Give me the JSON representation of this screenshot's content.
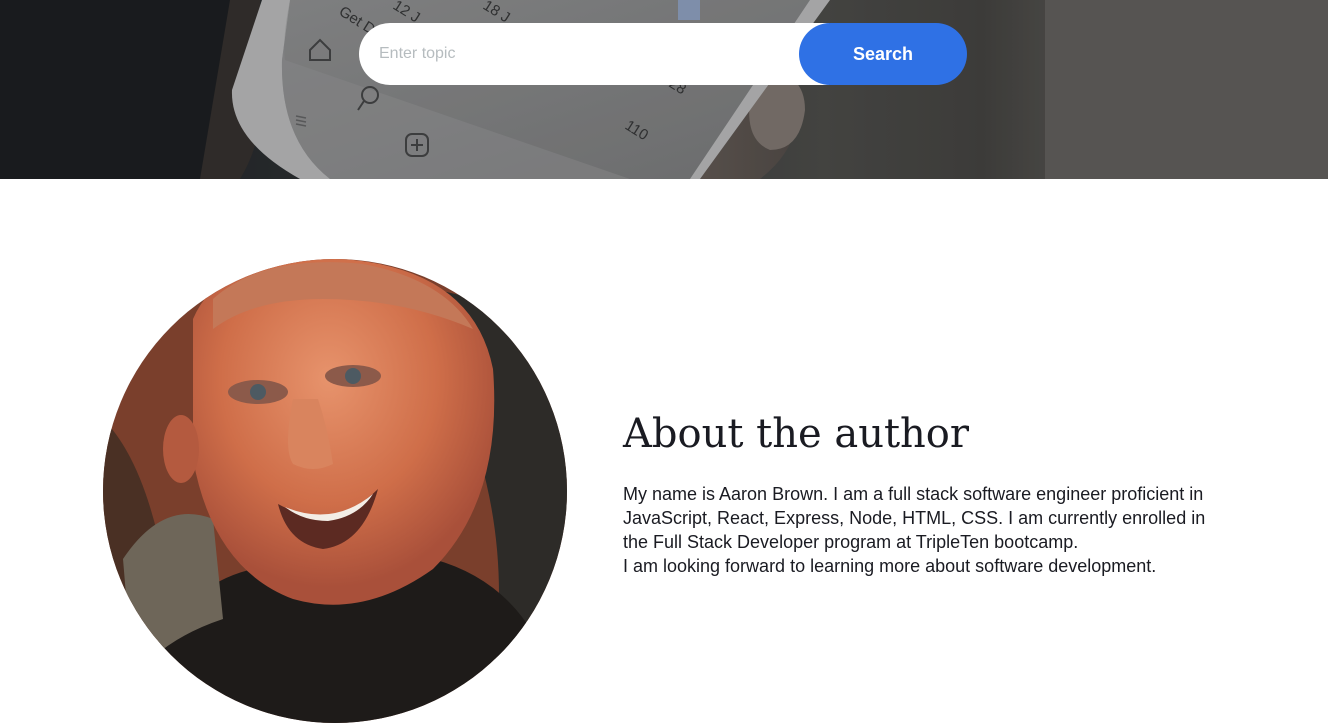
{
  "search": {
    "placeholder": "Enter topic",
    "value": "",
    "button_label": "Search"
  },
  "about": {
    "title": "About the author",
    "paragraph_1": "My name is Aaron Brown. I am a full stack software engineer proficient in JavaScript, React, Express, Node, HTML, CSS. I am currently enrolled in the Full Stack Developer program at TripleTen bootcamp.",
    "paragraph_2": "I am looking forward to learning more about software development."
  },
  "hero": {
    "phone_text": [
      "Get D",
      "12 J",
      "18 J",
      "28",
      "110"
    ]
  },
  "colors": {
    "accent": "#2f71e5",
    "text": "#1a1b22",
    "placeholder": "#b6bcbf",
    "background": "#ffffff"
  },
  "icons": [
    "home-icon",
    "search-icon",
    "add-icon",
    "menu-icon"
  ]
}
